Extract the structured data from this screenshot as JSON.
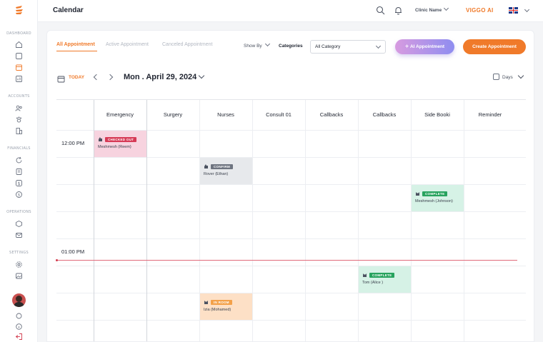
{
  "sidebar": {
    "sections": [
      "DASHBOARD",
      "ACCOUNTS",
      "FINANCIALS",
      "OPERATIONS",
      "SETTINGS"
    ]
  },
  "header": {
    "title": "Calendar",
    "clinic_label": "Clinic Name",
    "brand": "VIGGO AI"
  },
  "tabs": [
    "All Appointment",
    "Active Appointment",
    "Canceled Appointment"
  ],
  "filters": {
    "show_by": "Show By",
    "categories_label": "Categories",
    "category_value": "All Category"
  },
  "buttons": {
    "ai": "AI Appointment",
    "create": "Create Appointment"
  },
  "calendar": {
    "today_label": "TODAY",
    "date": "Mon . April 29, 2024",
    "view": "Days",
    "columns": [
      "Emergency",
      "Surgery",
      "Nurses",
      "Consult 01",
      "Callbacks",
      "Callbacks",
      "Side Booki",
      "Reminder"
    ],
    "times": [
      "12:00 PM",
      "01:00 PM"
    ]
  },
  "appointments": [
    {
      "status": "CHECKED OUT",
      "name": "Meshmesh (Reem)",
      "color": "#f7d3df",
      "badge": "#d63a56"
    },
    {
      "status": "CONFIRM",
      "name": "Rover (Ethan)",
      "color": "#e7e9ec",
      "badge": "#6e7480"
    },
    {
      "status": "COMPLETE",
      "name": "Meshmesh (Johnson)",
      "color": "#d6f2e6",
      "badge": "#27a35e"
    },
    {
      "status": "COMPLETE",
      "name": "Tom (Alice )",
      "color": "#d6f2e6",
      "badge": "#27a35e"
    },
    {
      "status": "IN ROOM",
      "name": "Izia (Mohamed)",
      "color": "#fde0c6",
      "badge": "#f3a14a"
    }
  ],
  "colors": {
    "accent": "#f07a2a",
    "now_line": "#e06a7a"
  }
}
